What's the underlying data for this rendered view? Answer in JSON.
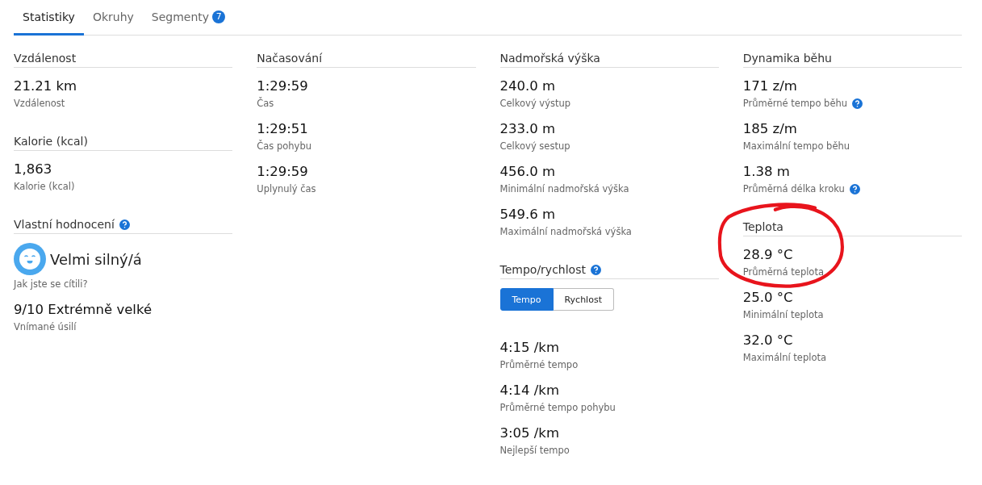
{
  "tabs": [
    {
      "label": "Statistiky",
      "selected": true
    },
    {
      "label": "Okruhy",
      "selected": false
    },
    {
      "label": "Segmenty",
      "selected": false,
      "badge": "7"
    }
  ],
  "columns": [
    {
      "sections": [
        {
          "title": "Vzdálenost",
          "items": [
            {
              "kind": "stat",
              "value": "21.21 km",
              "label": "Vzdálenost"
            }
          ]
        },
        {
          "title": "Kalorie (kcal)",
          "items": [
            {
              "kind": "stat",
              "value": "1,863",
              "label": "Kalorie (kcal)"
            }
          ]
        },
        {
          "title": "Vlastní hodnocení",
          "help": true,
          "items": [
            {
              "kind": "feeling",
              "value": "Velmi silný/á",
              "label": "Jak jste se cítili?"
            },
            {
              "kind": "stat",
              "value": "9/10 Extrémně velké",
              "label": "Vnímané úsilí"
            }
          ]
        }
      ]
    },
    {
      "sections": [
        {
          "title": "Načasování",
          "items": [
            {
              "kind": "stat",
              "value": "1:29:59",
              "label": "Čas"
            },
            {
              "kind": "stat",
              "value": "1:29:51",
              "label": "Čas pohybu"
            },
            {
              "kind": "stat",
              "value": "1:29:59",
              "label": "Uplynulý čas"
            }
          ]
        }
      ]
    },
    {
      "sections": [
        {
          "title": "Nadmořská výška",
          "items": [
            {
              "kind": "stat",
              "value": "240.0 m",
              "label": "Celkový výstup"
            },
            {
              "kind": "stat",
              "value": "233.0 m",
              "label": "Celkový sestup"
            },
            {
              "kind": "stat",
              "value": "456.0 m",
              "label": "Minimální nadmořská výška"
            },
            {
              "kind": "stat",
              "value": "549.6 m",
              "label": "Maximální nadmořská výška"
            }
          ]
        },
        {
          "title": "Tempo/rychlost",
          "help": true,
          "items": [
            {
              "kind": "toggle",
              "options": [
                {
                  "label": "Tempo",
                  "selected": true
                },
                {
                  "label": "Rychlost",
                  "selected": false
                }
              ]
            },
            {
              "kind": "stat",
              "value": "4:15 /km",
              "label": "Průměrné tempo"
            },
            {
              "kind": "stat",
              "value": "4:14 /km",
              "label": "Průměrné tempo pohybu"
            },
            {
              "kind": "stat",
              "value": "3:05 /km",
              "label": "Nejlepší tempo"
            }
          ]
        }
      ]
    },
    {
      "sections": [
        {
          "title": "Dynamika běhu",
          "items": [
            {
              "kind": "stat",
              "value": "171 z/m",
              "label": "Průměrné tempo běhu",
              "help": true
            },
            {
              "kind": "stat",
              "value": "185 z/m",
              "label": "Maximální tempo běhu"
            },
            {
              "kind": "stat",
              "value": "1.38 m",
              "label": "Průměrná délka kroku",
              "help": true
            }
          ]
        },
        {
          "title": "Teplota",
          "circled": true,
          "items": [
            {
              "kind": "stat",
              "value": "28.9 °C",
              "label": "Průměrná teplota"
            },
            {
              "kind": "stat",
              "value": "25.0 °C",
              "label": "Minimální teplota"
            },
            {
              "kind": "stat",
              "value": "32.0 °C",
              "label": "Maximální teplota"
            }
          ]
        }
      ]
    }
  ]
}
